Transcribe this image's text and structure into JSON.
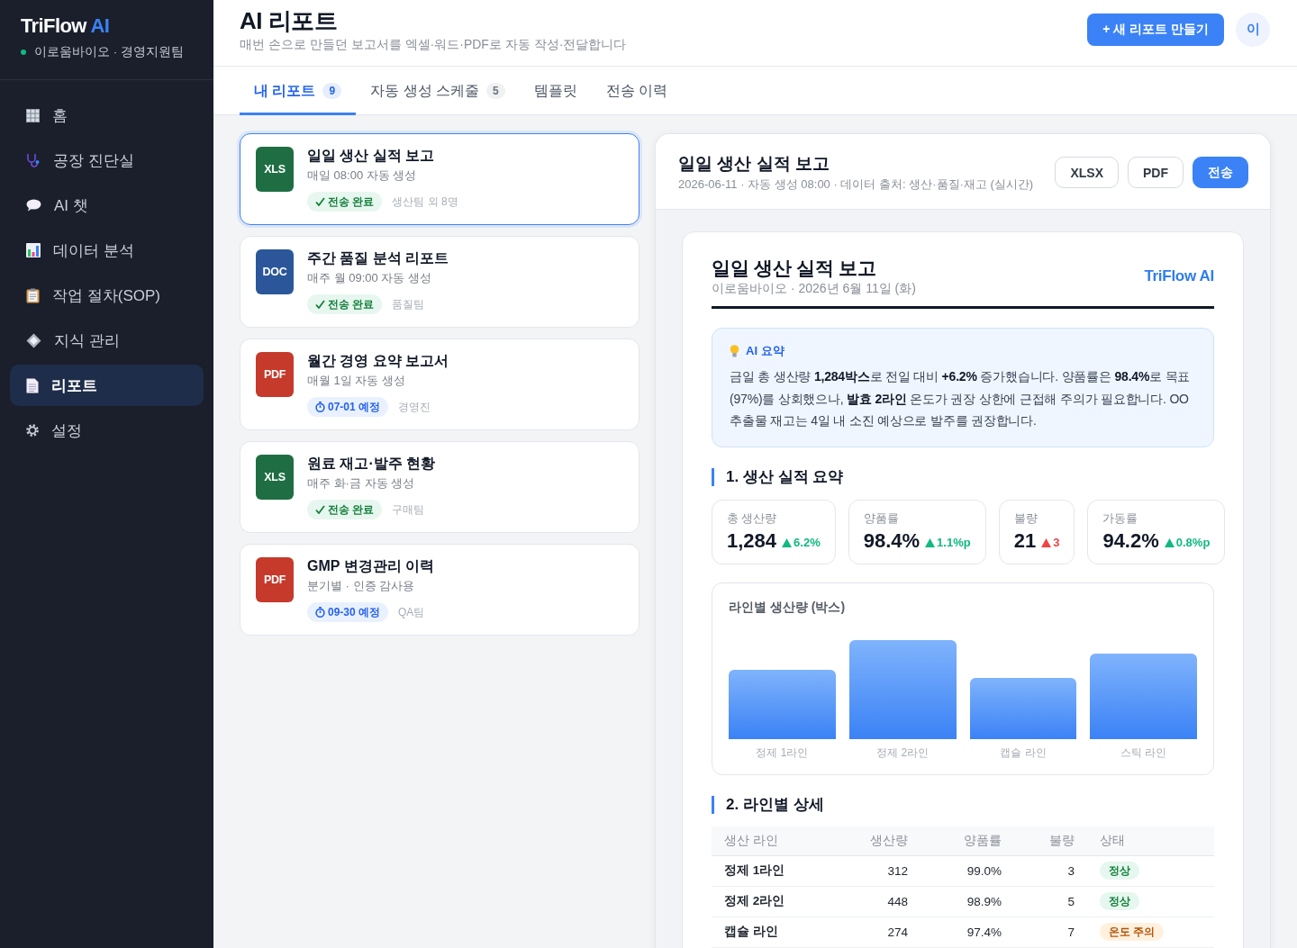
{
  "sidebar": {
    "brand": {
      "name": "TriFlow",
      "accent": "AI"
    },
    "org": "이로움바이오 · 경영지원팀",
    "items": [
      {
        "label": "홈",
        "selected": false
      },
      {
        "label": "공장 진단실",
        "selected": false
      },
      {
        "label": "AI 챗",
        "selected": false
      },
      {
        "label": "데이터 분석",
        "selected": false
      },
      {
        "label": "작업 절차(SOP)",
        "selected": false
      },
      {
        "label": "지식 관리",
        "selected": false
      },
      {
        "label": "리포트",
        "selected": true
      },
      {
        "label": "설정",
        "selected": false
      }
    ]
  },
  "header": {
    "title": "AI 리포트",
    "subtitle": "매번 손으로 만들던 보고서를 엑셀·워드·PDF로 자동 작성·전달합니다",
    "new_report_button": "+ 새 리포트 만들기",
    "avatar": "이"
  },
  "tabs": [
    {
      "label": "내 리포트",
      "count": "9",
      "selected": true
    },
    {
      "label": "자동 생성 스케줄",
      "count": "5",
      "selected": false
    },
    {
      "label": "템플릿",
      "selected": false
    },
    {
      "label": "전송 이력",
      "selected": false
    }
  ],
  "reports": [
    {
      "format": "XLS",
      "color": "#1f6e43",
      "title": "일일 생산 실적 보고",
      "schedule": "매일 08:00 자동 생성",
      "status": {
        "kind": "sent",
        "label": "전송 완료"
      },
      "recipients": "생산팀 외 8명",
      "selected": true
    },
    {
      "format": "DOC",
      "color": "#2b579a",
      "title": "주간 품질 분석 리포트",
      "schedule": "매주 월 09:00 자동 생성",
      "status": {
        "kind": "sent",
        "label": "전송 완료"
      },
      "recipients": "품질팀",
      "selected": false
    },
    {
      "format": "PDF",
      "color": "#c53a2b",
      "title": "월간 경영 요약 보고서",
      "schedule": "매월 1일 자동 생성",
      "status": {
        "kind": "scheduled",
        "label": "07-01 예정"
      },
      "recipients": "경영진",
      "selected": false
    },
    {
      "format": "XLS",
      "color": "#1f6e43",
      "title": "원료 재고·발주 현황",
      "schedule": "매주 화·금 자동 생성",
      "status": {
        "kind": "sent",
        "label": "전송 완료"
      },
      "recipients": "구매팀",
      "selected": false
    },
    {
      "format": "PDF",
      "color": "#c53a2b",
      "title": "GMP 변경관리 이력",
      "schedule": "분기별 · 인증 감사용",
      "status": {
        "kind": "scheduled",
        "label": "09-30 예정"
      },
      "recipients": "QA팀",
      "selected": false
    }
  ],
  "preview": {
    "title": "일일 생산 실적 보고",
    "meta": "2026-06-11 · 자동 생성 08:00 · 데이터 출처: 생산·품질·재고 (실시간)",
    "actions": [
      {
        "label": "XLSX",
        "kind": "outline"
      },
      {
        "label": "PDF",
        "kind": "outline"
      },
      {
        "label": "전송",
        "kind": "primary"
      }
    ],
    "document": {
      "title": "일일 생산 실적 보고",
      "subtitle": "이로움바이오 · 2026년 6월 11일 (화)",
      "brand": "TriFlow AI",
      "ai_summary": {
        "title": "AI 요약",
        "text": "금일 총 생산량 **1,284박스**로 전일 대비 **+6.2%** 증가했습니다. 양품률은 **98.4%**로 목표(97%)를 상회했으나, **발효 2라인** 온도가 권장 상한에 근접해 주의가 필요합니다. OO 추출물 재고는 4일 내 소진 예상으로 발주를 권장합니다."
      },
      "summary_section": {
        "heading": "1. 생산 실적 요약",
        "metrics": [
          {
            "label": "총 생산량",
            "value": "1,284",
            "delta": "6.2%",
            "kind": "good"
          },
          {
            "label": "양품률",
            "value": "98.4%",
            "delta": "1.1%p",
            "kind": "good"
          },
          {
            "label": "불량",
            "value": "21",
            "delta": "3",
            "kind": "bad"
          },
          {
            "label": "가동률",
            "value": "94.2%",
            "delta": "0.8%p",
            "kind": "good"
          }
        ],
        "chart": {
          "title": "라인별 생산량 (박스)",
          "bars": [
            {
              "label": "정제 1라인"
            },
            {
              "label": "정제 2라인"
            },
            {
              "label": "캡슐 라인"
            },
            {
              "label": "스틱 라인"
            }
          ]
        }
      },
      "detail_section": {
        "heading": "2. 라인별 상세",
        "table": {
          "columns": [
            "생산 라인",
            "생산량",
            "양품률",
            "불량",
            "상태"
          ],
          "rows": [
            {
              "line": "정제 1라인",
              "output": "312",
              "yield": "99.0%",
              "defects": "3",
              "status": {
                "label": "정상",
                "kind": "normal"
              }
            },
            {
              "line": "정제 2라인",
              "output": "448",
              "yield": "98.9%",
              "defects": "5",
              "status": {
                "label": "정상",
                "kind": "normal"
              }
            },
            {
              "line": "캡슐 라인",
              "output": "274",
              "yield": "97.4%",
              "defects": "7",
              "status": {
                "label": "온도 주의",
                "kind": "warning"
              }
            }
          ]
        }
      }
    }
  }
}
